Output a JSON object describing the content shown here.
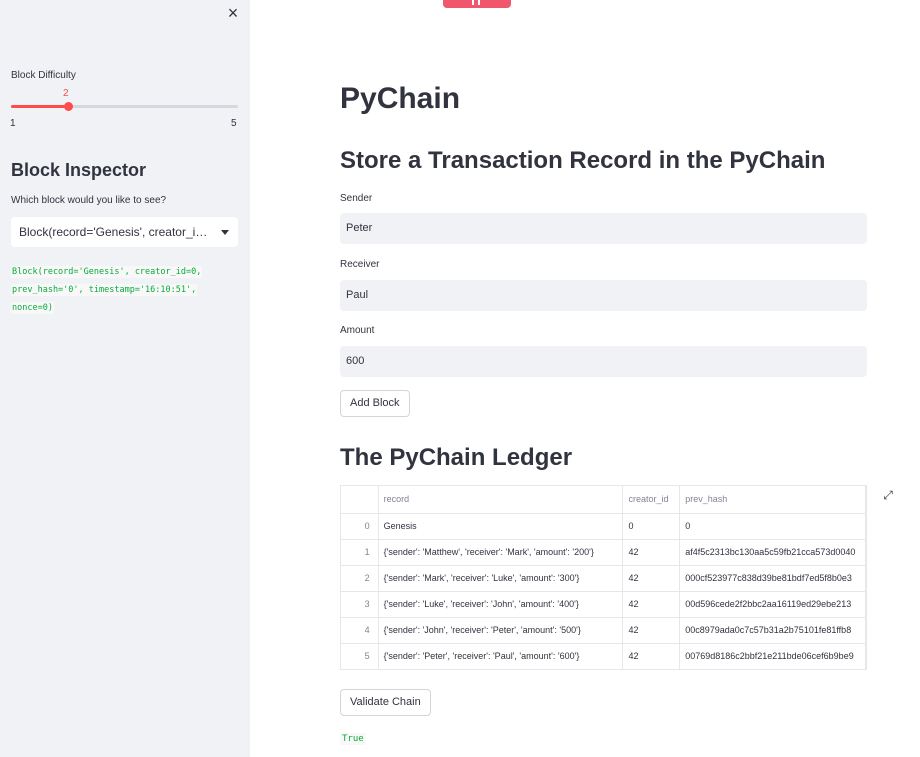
{
  "sidebar": {
    "close_icon": "×",
    "difficulty": {
      "label": "Block Difficulty",
      "value": "2",
      "min": "1",
      "max": "5",
      "fraction": 0.25
    },
    "inspector": {
      "title": "Block Inspector",
      "select_label": "Which block would you like to see?",
      "selected": "Block(record='Genesis', creator_id=0, prev_hash='0', timestamp='16:10:51', nonce=0)",
      "output_lines": [
        "Block(record='Genesis', creator_id=0,",
        "prev_hash='0', timestamp='16:10:51',",
        "nonce=0)"
      ]
    }
  },
  "colors": {
    "accent": "#ff4b4b",
    "code_green": "#09ab3b",
    "sidebar_bg": "#f0f2f6"
  },
  "main": {
    "title": "PyChain",
    "store_heading": "Store a Transaction Record in the PyChain",
    "sender": {
      "label": "Sender",
      "value": "Peter"
    },
    "receiver": {
      "label": "Receiver",
      "value": "Paul"
    },
    "amount": {
      "label": "Amount",
      "value": "600"
    },
    "add_block_label": "Add Block",
    "ledger_heading": "The PyChain Ledger",
    "ledger": {
      "columns": [
        "",
        "record",
        "creator_id",
        "prev_hash"
      ],
      "rows": [
        {
          "idx": "0",
          "record": "Genesis",
          "creator_id": "0",
          "prev_hash": "0"
        },
        {
          "idx": "1",
          "record": "{'sender': 'Matthew', 'receiver': 'Mark', 'amount': '200'}",
          "creator_id": "42",
          "prev_hash": "af4f5c2313bc130aa5c59fb21cca573d0040"
        },
        {
          "idx": "2",
          "record": "{'sender': 'Mark', 'receiver': 'Luke', 'amount': '300'}",
          "creator_id": "42",
          "prev_hash": "000cf523977c838d39be81bdf7ed5f8b0e3"
        },
        {
          "idx": "3",
          "record": "{'sender': 'Luke', 'receiver': 'John', 'amount': '400'}",
          "creator_id": "42",
          "prev_hash": "00d596cede2f2bbc2aa16119ed29ebe213"
        },
        {
          "idx": "4",
          "record": "{'sender': 'John', 'receiver': 'Peter', 'amount': '500'}",
          "creator_id": "42",
          "prev_hash": "00c8979ada0c7c57b31a2b75101fe81ffb8"
        },
        {
          "idx": "5",
          "record": "{'sender': 'Peter', 'receiver': 'Paul', 'amount': '600'}",
          "creator_id": "42",
          "prev_hash": "00769d8186c2bbf21e211bde06cef6b9be9"
        }
      ]
    },
    "expand_icon": "⤢",
    "validate_label": "Validate Chain",
    "validate_result": "True"
  }
}
